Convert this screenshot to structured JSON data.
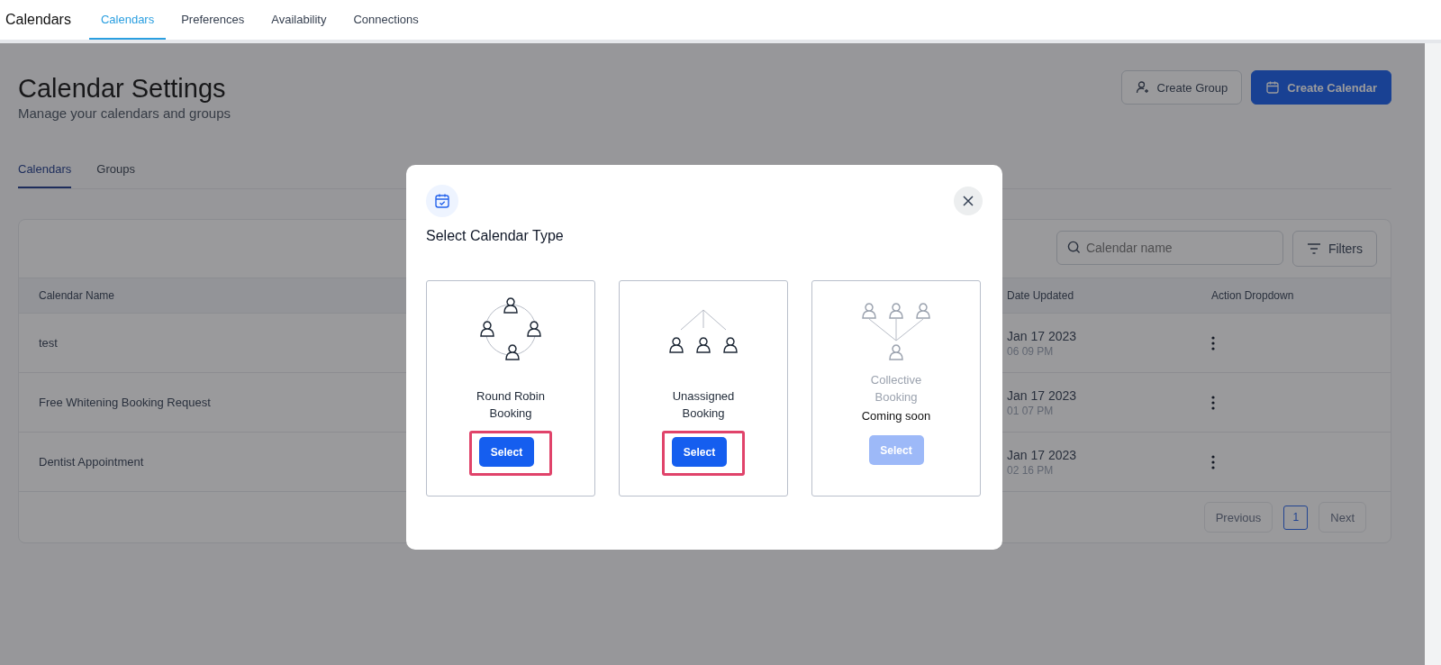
{
  "app": {
    "title": "Calendars"
  },
  "nav_tabs": [
    {
      "label": "Calendars",
      "selected": true
    },
    {
      "label": "Preferences",
      "selected": false
    },
    {
      "label": "Availability",
      "selected": false
    },
    {
      "label": "Connections",
      "selected": false
    }
  ],
  "page": {
    "title": "Calendar Settings",
    "subtitle": "Manage your calendars and groups"
  },
  "actions": [
    {
      "kind": "group",
      "label": "Create Group"
    },
    {
      "kind": "calendar",
      "label": "Create Calendar"
    }
  ],
  "sub_tabs": [
    {
      "label": "Calendars",
      "selected": true
    },
    {
      "label": "Groups",
      "selected": false
    }
  ],
  "search": {
    "placeholder": "Calendar name"
  },
  "filters_button": "Filters",
  "table": {
    "columns": [
      "Calendar Name",
      "Date Updated",
      "Action Dropdown"
    ],
    "rows": [
      {
        "name": "test",
        "date": "Jan 17 2023",
        "time": "06 09 PM"
      },
      {
        "name": "Free Whitening Booking Request",
        "date": "Jan 17 2023",
        "time": "01 07 PM"
      },
      {
        "name": "Dentist Appointment",
        "date": "Jan 17 2023",
        "time": "02 16 PM"
      }
    ]
  },
  "pagination": {
    "previous": "Previous",
    "pages": [
      {
        "label": "1",
        "selected": true
      }
    ],
    "next": "Next"
  },
  "modal": {
    "title": "Select Calendar Type",
    "options": [
      {
        "kind": "round-robin",
        "label": "Round Robin Booking",
        "button": "Select",
        "disabled": false,
        "highlighted": true
      },
      {
        "kind": "unassigned",
        "label": "Unassigned Booking",
        "button": "Select",
        "disabled": false,
        "highlighted": true
      },
      {
        "kind": "collective",
        "label": "Collective Booking",
        "note": "Coming soon",
        "button": "Select",
        "disabled": true,
        "highlighted": false
      }
    ]
  }
}
